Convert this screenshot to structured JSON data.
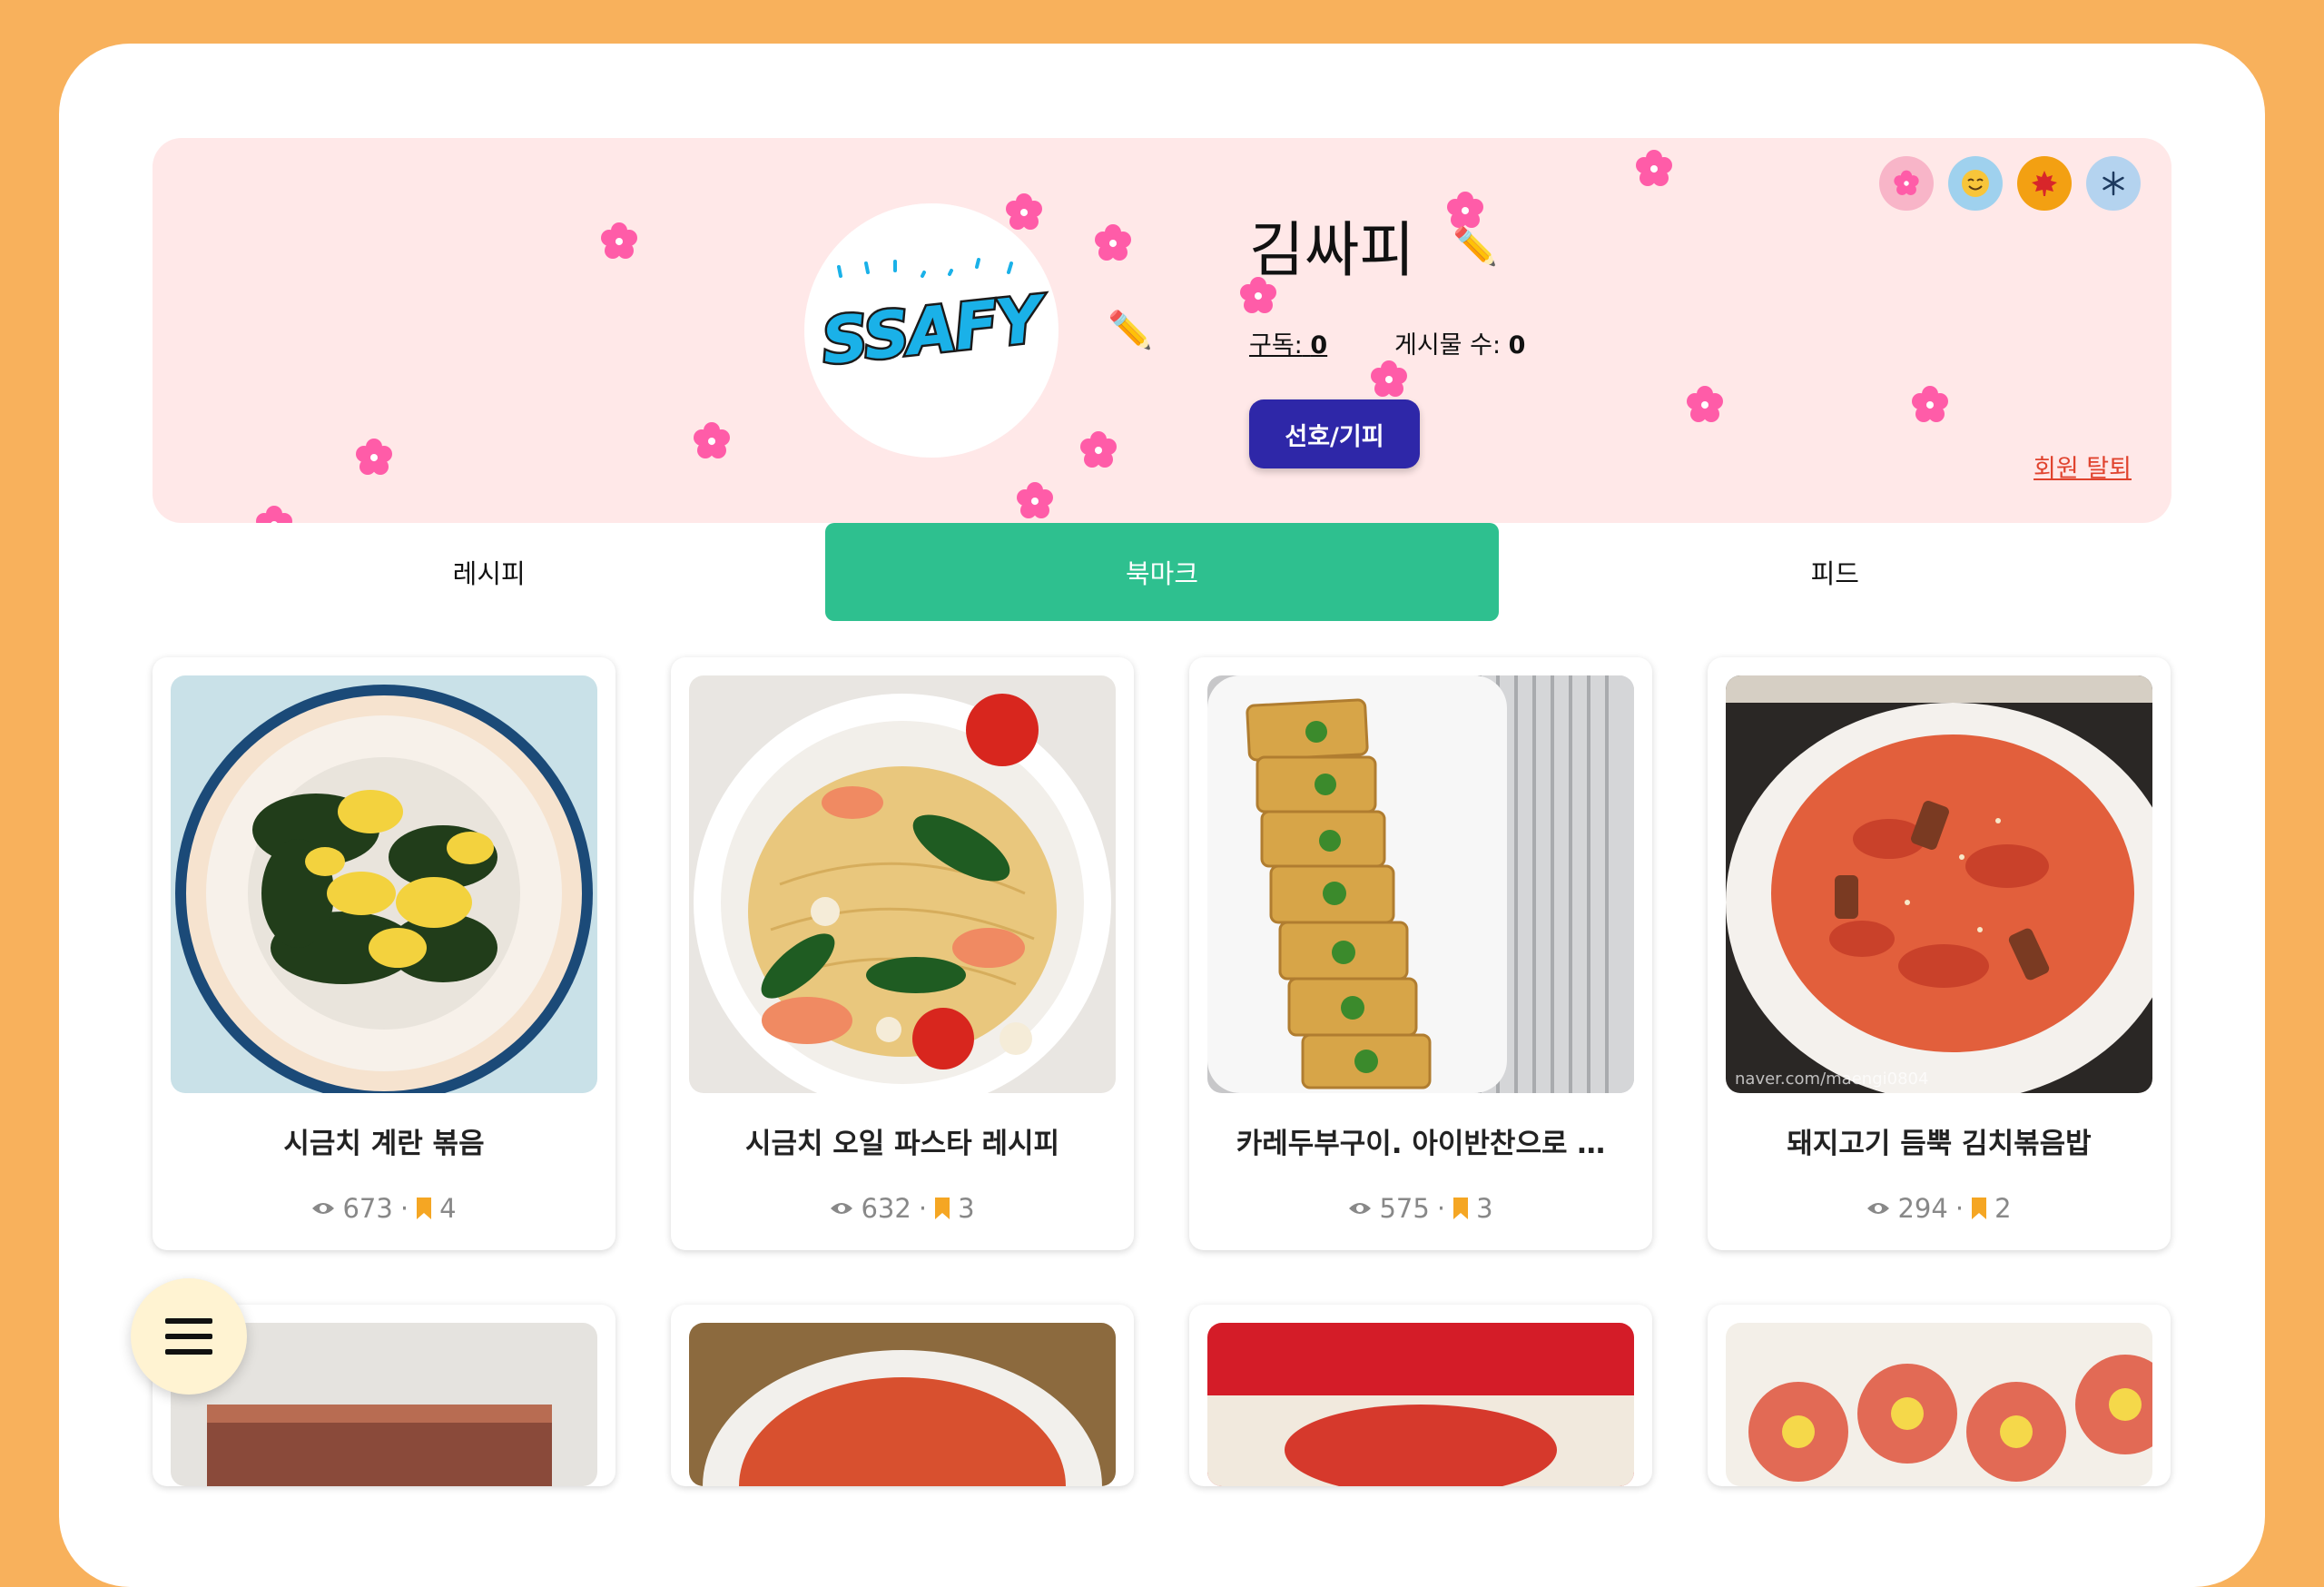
{
  "profile": {
    "name": "김싸피",
    "avatar_text": "SSAFY",
    "subscribe_label": "구독:",
    "subscribe_count": "0",
    "posts_label": "게시물 수:",
    "posts_count": "0",
    "preference_button": "선호/기피",
    "withdraw_link": "회원 탈퇴",
    "theme_icons": [
      "blossom-theme",
      "smile-theme",
      "maple-leaf-theme",
      "snowflake-theme"
    ],
    "theme_colors": [
      "#f8b5c8",
      "#9fd1ee",
      "#f3a012",
      "#b4d3ef"
    ]
  },
  "tabs": [
    {
      "label": "레시피",
      "active": false
    },
    {
      "label": "북마크",
      "active": true
    },
    {
      "label": "피드",
      "active": false
    }
  ],
  "cards": [
    {
      "title": "시금치 계란 볶음",
      "views": "673",
      "bookmarks": "4"
    },
    {
      "title": "시금치 오일 파스타 레시피",
      "views": "632",
      "bookmarks": "3"
    },
    {
      "title": "카레두부구이. 아이반찬으로 …",
      "views": "575",
      "bookmarks": "3"
    },
    {
      "title": "돼지고기 듬뿍 김치볶음밥",
      "views": "294",
      "bookmarks": "2"
    }
  ],
  "colors": {
    "background": "#f8b15c",
    "profile_bg": "#ffe8e8",
    "accent_tab": "#2ec08f",
    "button": "#2e27a8",
    "bookmark": "#f5a623",
    "withdraw": "#e0432e"
  },
  "menu_icon": "hamburger-menu-icon"
}
